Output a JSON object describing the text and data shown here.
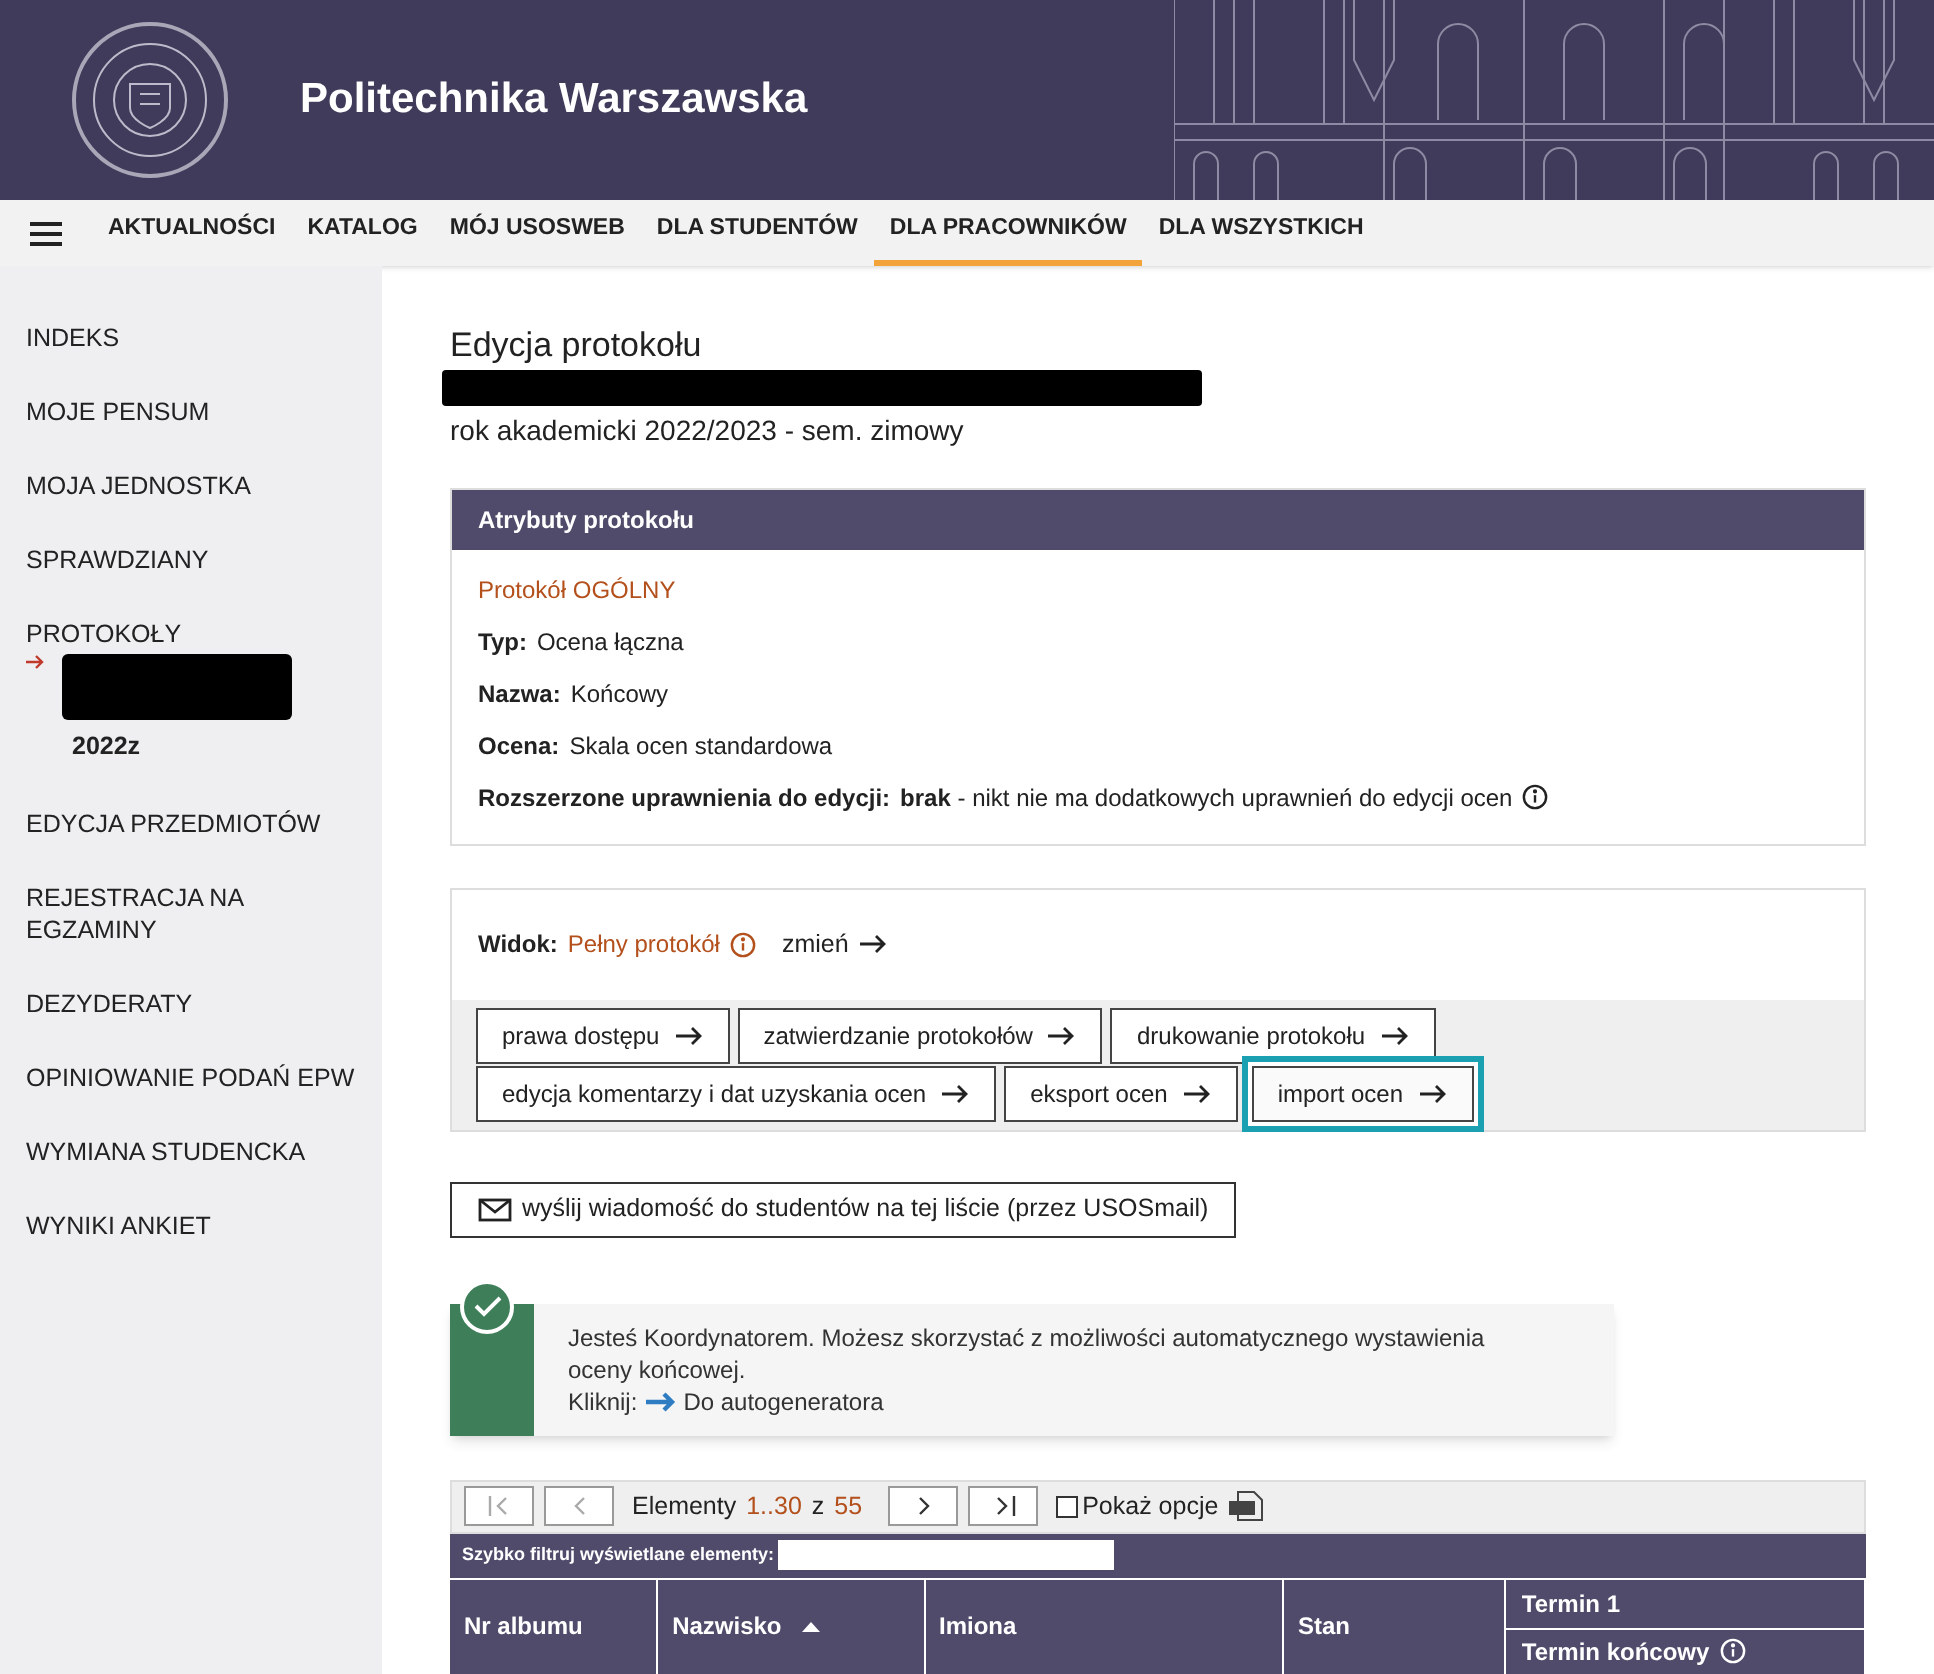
{
  "header": {
    "title": "Politechnika Warszawska"
  },
  "nav": {
    "items": [
      {
        "label": "AKTUALNOŚCI",
        "selected": false
      },
      {
        "label": "KATALOG",
        "selected": false
      },
      {
        "label": "MÓJ USOSWEB",
        "selected": false
      },
      {
        "label": "DLA STUDENTÓW",
        "selected": false
      },
      {
        "label": "DLA PRACOWNIKÓW",
        "selected": true
      },
      {
        "label": "DLA WSZYSTKICH",
        "selected": false
      }
    ]
  },
  "sidebar": {
    "items": [
      {
        "label": "INDEKS"
      },
      {
        "label": "MOJE PENSUM"
      },
      {
        "label": "MOJA JEDNOSTKA"
      },
      {
        "label": "SPRAWDZIANY"
      },
      {
        "label": "PROTOKOŁY",
        "current_sub": "2022z"
      },
      {
        "label": "EDYCJA PRZEDMIOTÓW"
      },
      {
        "label": "REJESTRACJA NA EGZAMINY"
      },
      {
        "label": "DEZYDERATY"
      },
      {
        "label": "OPINIOWANIE PODAŃ EPW"
      },
      {
        "label": "WYMIANA STUDENCKA"
      },
      {
        "label": "WYNIKI ANKIET"
      }
    ]
  },
  "page": {
    "title": "Edycja protokołu",
    "subtitle": "rok akademicki 2022/2023 - sem. zimowy"
  },
  "attributes": {
    "heading": "Atrybuty protokołu",
    "kind_label": "Protokół OGÓLNY",
    "fields": [
      {
        "label": "Typ:",
        "value": "Ocena łączna"
      },
      {
        "label": "Nazwa:",
        "value": "Końcowy"
      },
      {
        "label": "Ocena:",
        "value": "Skala ocen standardowa"
      }
    ],
    "extended": {
      "label": "Rozszerzone uprawnienia do edycji:",
      "value": "**brak** - nikt nie ma dodatkowych uprawnień do edycji ocen"
    }
  },
  "view": {
    "label": "Widok:",
    "value": "Pełny protokół",
    "change": "zmień",
    "buttons": [
      {
        "label": "prawa dostępu",
        "highlighted": false
      },
      {
        "label": "zatwierdzanie protokołów",
        "highlighted": false
      },
      {
        "label": "drukowanie protokołu",
        "highlighted": false
      },
      {
        "label": "edycja komentarzy i dat uzyskania ocen",
        "highlighted": false
      },
      {
        "label": "eksport ocen",
        "highlighted": false
      },
      {
        "label": "import ocen",
        "highlighted": true
      }
    ]
  },
  "mail_button": {
    "label": "wyślij wiadomość do studentów na tej liście (przez USOSmail)"
  },
  "notice": {
    "text": "Jesteś Koordynatorem. Możesz skorzystać z możliwości automatycznego wystawienia oceny końcowej.",
    "click_label": "Kliknij:",
    "link": "Do autogeneratora"
  },
  "pager": {
    "label": "Elementy",
    "range": "1..30",
    "of": "z",
    "total": "55",
    "options": {
      "label": "Pokaż opcje",
      "checked": false
    }
  },
  "filter": {
    "label": "Szybko filtruj wyświetlane elementy:"
  },
  "table": {
    "columns": [
      {
        "label": "Nr albumu"
      },
      {
        "label": "Nazwisko",
        "sorted": true
      },
      {
        "label": "Imiona"
      },
      {
        "label": "Stan"
      },
      {
        "label": "Termin 1",
        "sub": "Termin końcowy"
      }
    ]
  }
}
